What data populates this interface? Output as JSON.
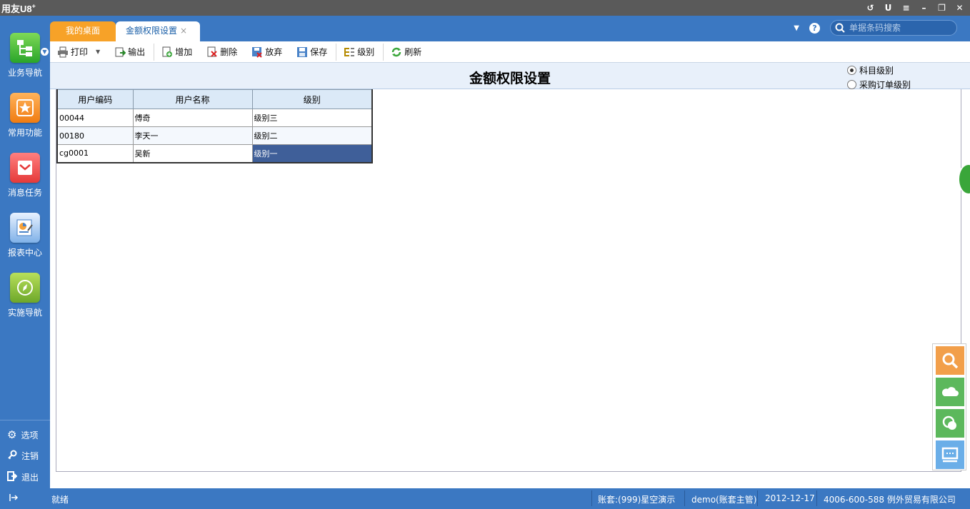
{
  "app": {
    "logo_text": "用友U8",
    "logo_sup": "+"
  },
  "window_controls": [
    "↺",
    "U",
    "≡",
    "–",
    "❐",
    "✕"
  ],
  "sidebar": {
    "items": [
      {
        "label": "业务导航",
        "icon": "tree-icon"
      },
      {
        "label": "常用功能",
        "icon": "star-icon"
      },
      {
        "label": "消息任务",
        "icon": "message-icon"
      },
      {
        "label": "报表中心",
        "icon": "report-icon"
      },
      {
        "label": "实施导航",
        "icon": "compass-icon"
      }
    ],
    "commands": [
      {
        "label": "选项",
        "icon": "gear-icon"
      },
      {
        "label": "注销",
        "icon": "key-icon"
      },
      {
        "label": "退出",
        "icon": "exit-icon"
      }
    ]
  },
  "tabs": [
    {
      "label": "我的桌面"
    },
    {
      "label": "金额权限设置",
      "close": "×"
    }
  ],
  "search": {
    "placeholder": "单据条码搜索"
  },
  "toolbar": {
    "print": "打印",
    "export": "输出",
    "add": "增加",
    "delete": "删除",
    "discard": "放弃",
    "save": "保存",
    "level": "级别",
    "refresh": "刷新"
  },
  "page": {
    "title": "金额权限设置",
    "radio_options": [
      {
        "label": "科目级别",
        "checked": true
      },
      {
        "label": "采购订单级别",
        "checked": false
      }
    ]
  },
  "table": {
    "headers": [
      "用户编码",
      "用户名称",
      "级别"
    ],
    "rows": [
      [
        "00044",
        "傅奇",
        "级别三"
      ],
      [
        "00180",
        "李天一",
        "级别二"
      ],
      [
        "cg0001",
        "吴新",
        "级别一"
      ]
    ],
    "selected": {
      "row": 2,
      "col": 2
    }
  },
  "status": {
    "ready": "就绪",
    "account": "账套:(999)星空演示",
    "user": "demo(账套主管)",
    "date": "2012-12-17",
    "company": "4006-600-588 例外贸易有限公司"
  },
  "colors": {
    "accent": "#3b78c2",
    "tab_orange": "#f7a228",
    "selection": "#3f5f99"
  }
}
